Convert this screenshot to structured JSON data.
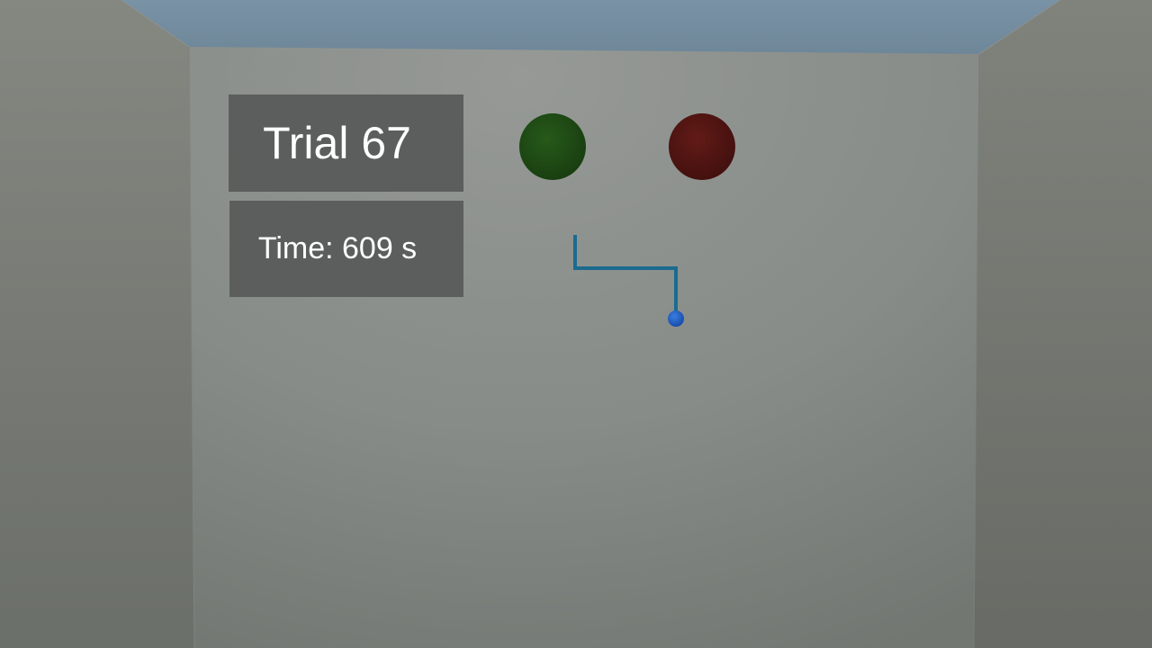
{
  "hud": {
    "trial_label": "Trial 67",
    "time_label": "Time: 609 s"
  },
  "targets": [
    {
      "name": "green-target",
      "color": "#1f4a14"
    },
    {
      "name": "red-target",
      "color": "#521512"
    }
  ],
  "cursor": {
    "color": "#1f5fc4"
  },
  "trace": {
    "color": "#1a6a8e"
  },
  "colors": {
    "sky": "#7890a2",
    "back_wall": "#8b908c",
    "side_wall": "#7b7f79",
    "panel": "#5c5e5d",
    "panel_text": "#ffffff"
  }
}
